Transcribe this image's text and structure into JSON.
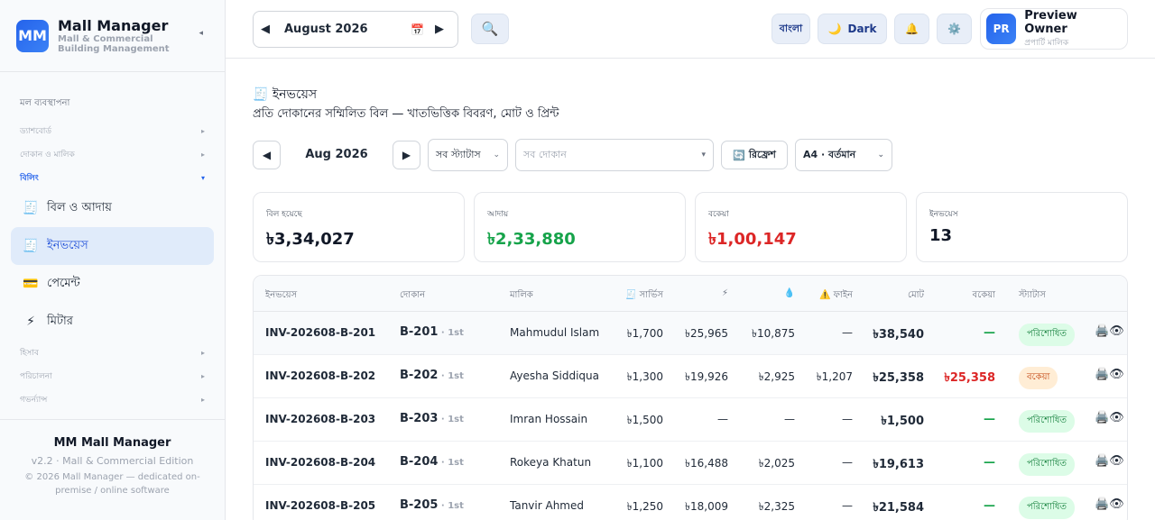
{
  "brand": {
    "logo": "MM",
    "title": "Mall Manager",
    "subtitle_l1": "Mall & Commercial",
    "subtitle_l2": "Building Management",
    "collapse": "◂"
  },
  "sidebar": {
    "heading": "মল ব্যবস্থাপনা",
    "groups": [
      {
        "label": "ড্যাশবোর্ড",
        "chev": "▸"
      },
      {
        "label": "দোকান ও মালিক",
        "chev": "▸"
      },
      {
        "label": "বিলিং",
        "chev": "▾"
      },
      {
        "label": "হিসাব",
        "chev": "▸"
      },
      {
        "label": "পরিচালনা",
        "chev": "▸"
      },
      {
        "label": "গভর্ন্যান্স",
        "chev": "▸"
      }
    ],
    "items": [
      {
        "label": "বিল ও আদায়",
        "icon": "bill-icon"
      },
      {
        "label": "ইনভয়েস",
        "icon": "invoice-icon"
      },
      {
        "label": "পেমেন্ট",
        "icon": "card-icon"
      },
      {
        "label": "মিটার",
        "icon": "bolt-icon"
      }
    ],
    "footer": {
      "title": "MM Mall Manager",
      "version": "v2.2 · Mall & Commercial Edition",
      "copy": "© 2026 Mall Manager — dedicated on-premise / online software"
    }
  },
  "topbar": {
    "month": "August  2026",
    "lang": "বাংলা",
    "dark": "Dark",
    "user_initials": "PR",
    "user_name": "Preview Owner",
    "user_role": "প্রপার্টি মালিক"
  },
  "page": {
    "title": "ইনভয়েস",
    "subtitle": "প্রতি দোকানের সম্মিলিত বিল — খাতভিত্তিক বিবরণ, মোট ও প্রিন্ট",
    "filter_month": "Aug 2026",
    "status_select": "সব স্ট্যাটাস",
    "shop_select_placeholder": "সব দোকান",
    "refresh": "রিফ্রেশ",
    "paper_select": "A4 · বর্তমান"
  },
  "summary": [
    {
      "label": "বিল হয়েছে",
      "value": "৳3,34,027",
      "color": "#111827"
    },
    {
      "label": "আদায়",
      "value": "৳2,33,880",
      "color": "#16a34a"
    },
    {
      "label": "বকেয়া",
      "value": "৳1,00,147",
      "color": "#dc2626"
    },
    {
      "label": "ইনভয়েস",
      "value": "13",
      "color": "#111827"
    }
  ],
  "table": {
    "headers": {
      "invoice": "ইনভয়েস",
      "shop": "দোকান",
      "owner": "মালিক",
      "service": "🧾 সার্ভিস",
      "elec": "⚡",
      "water": "💧",
      "fine": "⚠️ ফাইন",
      "total": "মোট",
      "due": "বকেয়া",
      "status": "স্ট্যাটাস"
    },
    "rows": [
      {
        "invoice": "INV-202608-B-201",
        "shop": "B-201",
        "floor": " · 1st",
        "owner": "Mahmudul Islam",
        "service": "৳1,700",
        "elec": "৳25,965",
        "water": "৳10,875",
        "fine": "—",
        "total": "৳38,540",
        "due": "—",
        "status": "পরিশোধিত",
        "state": "paid"
      },
      {
        "invoice": "INV-202608-B-202",
        "shop": "B-202",
        "floor": " · 1st",
        "owner": "Ayesha Siddiqua",
        "service": "৳1,300",
        "elec": "৳19,926",
        "water": "৳2,925",
        "fine": "৳1,207",
        "total": "৳25,358",
        "due": "৳25,358",
        "status": "বকেয়া",
        "state": "due"
      },
      {
        "invoice": "INV-202608-B-203",
        "shop": "B-203",
        "floor": " · 1st",
        "owner": "Imran Hossain",
        "service": "৳1,500",
        "elec": "—",
        "water": "—",
        "fine": "—",
        "total": "৳1,500",
        "due": "—",
        "status": "পরিশোধিত",
        "state": "paid"
      },
      {
        "invoice": "INV-202608-B-204",
        "shop": "B-204",
        "floor": " · 1st",
        "owner": "Rokeya Khatun",
        "service": "৳1,100",
        "elec": "৳16,488",
        "water": "৳2,025",
        "fine": "—",
        "total": "৳19,613",
        "due": "—",
        "status": "পরিশোধিত",
        "state": "paid"
      },
      {
        "invoice": "INV-202608-B-205",
        "shop": "B-205",
        "floor": " · 1st",
        "owner": "Tanvir Ahmed",
        "service": "৳1,250",
        "elec": "৳18,009",
        "water": "৳2,325",
        "fine": "—",
        "total": "৳21,584",
        "due": "—",
        "status": "পরিশোধিত",
        "state": "paid"
      }
    ]
  },
  "colors": {
    "accent": "#2563eb",
    "paid": "#16a34a",
    "due": "#dc2626"
  }
}
